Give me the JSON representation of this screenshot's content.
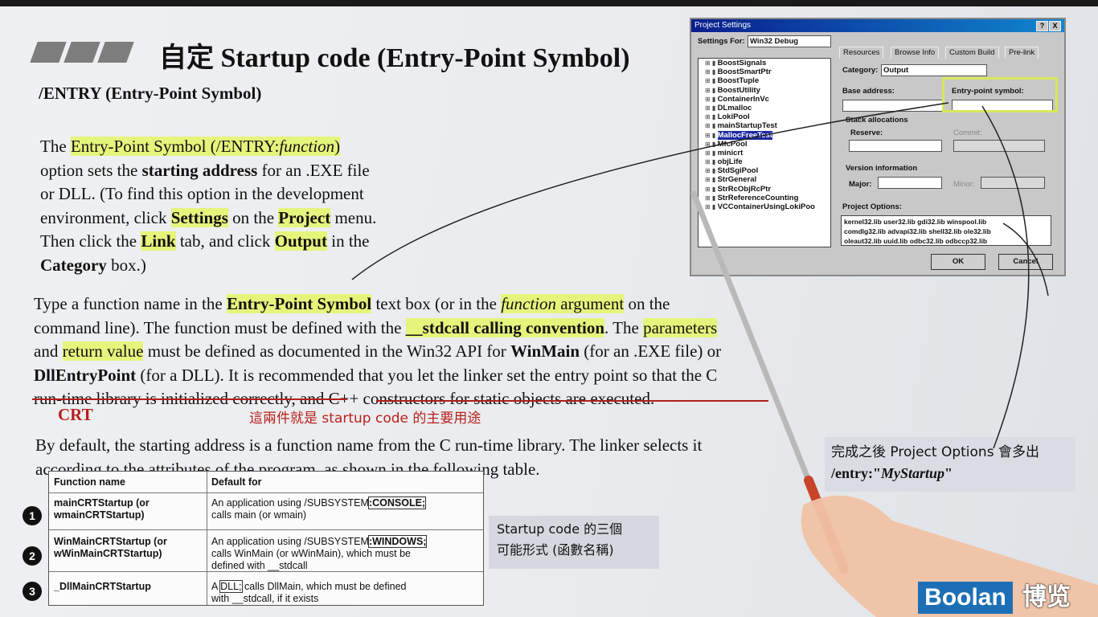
{
  "slide": {
    "title": "自定 Startup code (Entry-Point Symbol)",
    "subtitle": "/ENTRY (Entry-Point Symbol)",
    "p1": {
      "l1a": "The ",
      "l1b": "Entry-Point Symbol (/ENTRY:",
      "l1c": "function",
      "l1d": ")",
      "l2a": "option sets the ",
      "l2b": "starting address",
      "l2c": " for an .EXE file",
      "l3": "or DLL. (To find this option in the development",
      "l4a": "environment, click ",
      "l4b": "Settings",
      "l4c": " on the ",
      "l4d": "Project",
      "l4e": " menu.",
      "l5a": "Then click the ",
      "l5b": "Link",
      "l5c": " tab, and click ",
      "l5d": "Output",
      "l5e": " in the",
      "l6a": "Category",
      "l6b": " box.)"
    },
    "p2": {
      "l1a": "Type a function name in the ",
      "l1b": "Entry-Point Symbol",
      "l1c": " text box (or in the ",
      "l1d": "function",
      "l1e": " argument",
      "l1f": " on the",
      "l2a": "command line). The function must be defined with the ",
      "l2b": "__stdcall calling convention",
      "l2c": ". The ",
      "l2d": "parameters",
      "l3a": "and ",
      "l3b": "return value",
      "l3c": " must be defined as documented in the Win32 API for ",
      "l3d": "WinMain",
      "l3e": " (for an .EXE file) or",
      "l4a": "DllEntryPoint",
      "l4b": " (for a DLL). It is recommended that you let the linker set the entry point so that the C",
      "l5": "run-time library is initialized correctly, and C++ constructors for static objects are executed."
    },
    "crt_label": "CRT",
    "zh_note": "這兩件就是 startup code 的主要用途",
    "p3": {
      "l1": "By default, the starting address is a function name from the C run-time library. The linker selects it",
      "l2": "according to the attributes of the program, as shown in the following table."
    },
    "table": {
      "col1": "Function name",
      "col2": "Default for",
      "rows": [
        {
          "num": "1",
          "fn1": "mainCRTStartup (or",
          "fn2": "wmainCRTStartup)",
          "d1a": "An application using /SUBSYSTEM",
          "d1b": ":CONSOLE;",
          "d2": "calls main (or wmain)",
          "d3": ""
        },
        {
          "num": "2",
          "fn1": "WinMainCRTStartup (or",
          "fn2": "wWinMainCRTStartup)",
          "d1a": "An application using /SUBSYSTEM",
          "d1b": ":WINDOWS;",
          "d2": "calls WinMain (or wWinMain), which must be",
          "d3": "defined with __stdcall"
        },
        {
          "num": "3",
          "fn1": "_DllMainCRTStartup",
          "fn2": "",
          "d1a": "A ",
          "d1b": "DLL;",
          "d2": " calls DllMain, which must be defined",
          "d3": "with __stdcall, if it exists"
        }
      ]
    },
    "note_left": {
      "l1": "Startup code 的三個",
      "l2": "可能形式 (函數名稱)"
    },
    "note_right": {
      "l1": "完成之後 Project Options 會多出",
      "l2a": "/entry:\"",
      "l2b": "MyStartup",
      "l2c": "\""
    }
  },
  "dialog": {
    "title": "Project Settings",
    "settings_for_label": "Settings For:",
    "settings_for_value": "Win32 Debug",
    "tabs": [
      "Resources",
      "Browse Info",
      "Custom Build",
      "Pre-link"
    ],
    "tree": [
      "BoostSignals",
      "BoostSmartPtr",
      "BoostTuple",
      "BoostUtility",
      "ContainerInVc",
      "DLmalloc",
      "LokiPool",
      "mainStartupTest",
      "MallocFreeTest",
      "MfcPool",
      "minicrt",
      "objLife",
      "StdSgiPool",
      "StrGeneral",
      "StrRcObjRcPtr",
      "StrReferenceCounting",
      "VCContainerUsingLokiPoo"
    ],
    "tree_selected_index": 8,
    "category_label": "Category:",
    "category_value": "Output",
    "base_address_label": "Base address:",
    "entry_symbol_label": "Entry-point symbol:",
    "stack_label": "Stack allocations",
    "reserve_label": "Reserve:",
    "commit_label": "Commit:",
    "version_label": "Version information",
    "major_label": "Major:",
    "minor_label": "Minor:",
    "options_label": "Project Options:",
    "options_l1": "kernel32.lib user32.lib gdi32.lib winspool.lib",
    "options_l2": "comdlg32.lib advapi32.lib shell32.lib ole32.lib",
    "options_l3": "oleaut32.lib uuid.lib odbc32.lib odbccp32.lib",
    "ok": "OK",
    "cancel": "Cancel",
    "help": "?",
    "close": "X"
  },
  "logo": {
    "text": "Boolan",
    "zh": "博览"
  },
  "colors": {
    "highlight": "#e5f57c",
    "red": "#b8201c",
    "logo_blue": "#1c6fb4"
  }
}
